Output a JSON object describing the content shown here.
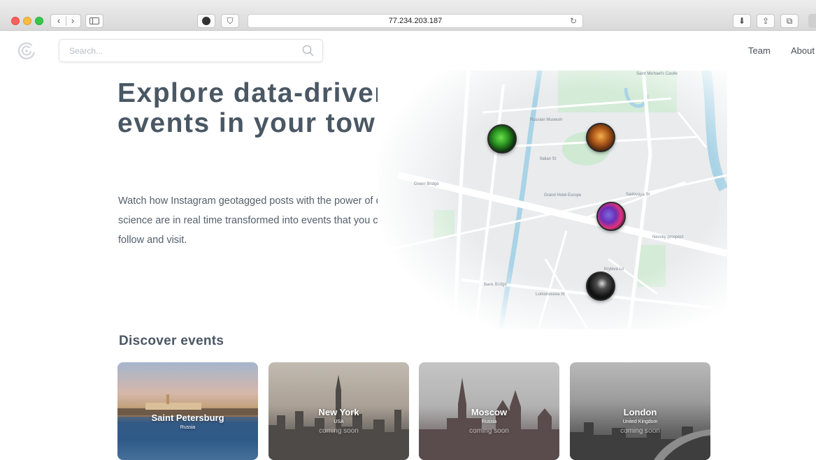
{
  "browser": {
    "url": "77.234.203.187",
    "back_glyph": "‹",
    "forward_glyph": "›",
    "reload_glyph": "↻",
    "download_glyph": "⬇",
    "share_glyph": "⇪",
    "tabs_glyph": "⧉",
    "shield_glyph": "⛉"
  },
  "header": {
    "search_placeholder": "Search...",
    "nav": [
      {
        "label": "Team"
      },
      {
        "label": "About"
      }
    ]
  },
  "hero": {
    "title": "Explore data-driven events in your town",
    "description": "Watch how Instagram geotagged posts with the power of data science are in real time transformed into events that you can view, follow and visit."
  },
  "map": {
    "labels": [
      "Saint Michael's Castle",
      "Russian Museum",
      "Italian St",
      "Green Bridge",
      "Grand Hotel Europe",
      "Nevsky prospect",
      "Sadovaya St",
      "Bank Bridge",
      "Lomonosova St",
      "Kryleva Ln"
    ]
  },
  "discover": {
    "title": "Discover events",
    "cards": [
      {
        "city": "Saint Petersburg",
        "country": "Russia",
        "status": ""
      },
      {
        "city": "New York",
        "country": "USA",
        "status": "coming soon"
      },
      {
        "city": "Moscow",
        "country": "Russia",
        "status": "coming soon"
      },
      {
        "city": "London",
        "country": "United Kingdom",
        "status": "coming soon"
      }
    ]
  },
  "colors": {
    "title": "#4a5764",
    "map_street": "#ffffff",
    "map_water": "#a9d3e6",
    "map_park": "#cfe9d3"
  }
}
